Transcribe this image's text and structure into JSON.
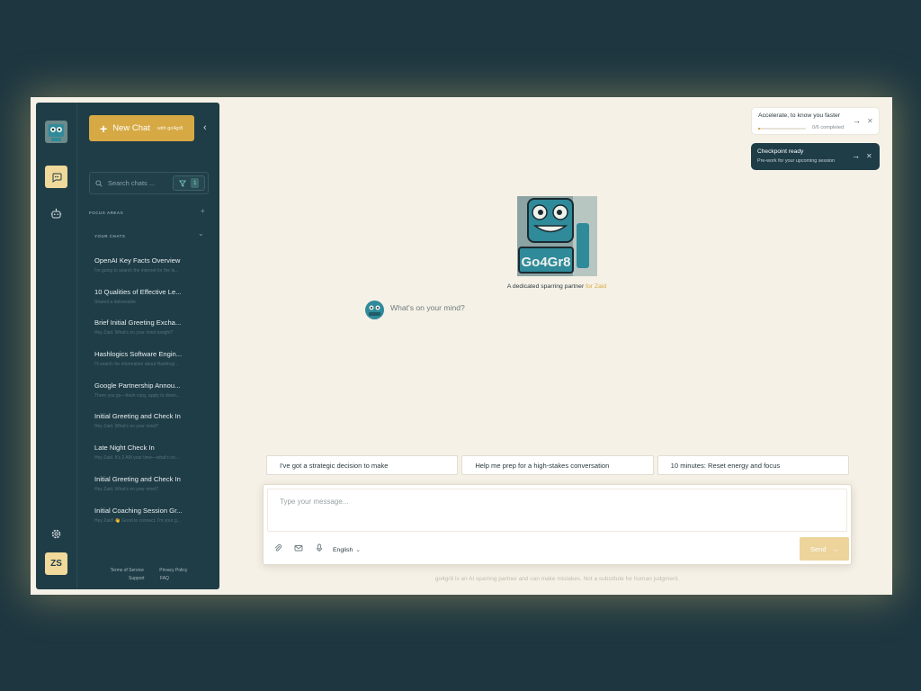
{
  "sidebar": {
    "new_chat_label": "New Chat",
    "new_chat_sub": "with go4gr8",
    "search_placeholder": "Search chats ...",
    "filter_count": "1",
    "focus_areas_label": "FOCUS AREAS",
    "your_chats_label": "YOUR CHATS",
    "chats": [
      {
        "title": "OpenAI Key Facts Overview",
        "preview": "I'm going to search the internet for the la..."
      },
      {
        "title": "10 Qualities of Effective Le...",
        "preview": "Shared a deliverable"
      },
      {
        "title": "Brief Initial Greeting Excha...",
        "preview": "Hey Zaid. What's on your mind tonight?"
      },
      {
        "title": "Hashlogics Software Engin...",
        "preview": "I'll search for information about Hashlogi..."
      },
      {
        "title": "Google Partnership Annou...",
        "preview": "There you go—fresh copy, apply to down..."
      },
      {
        "title": "Initial Greeting and Check In",
        "preview": "Hey Zaid. What's on your mind?"
      },
      {
        "title": "Late Night Check In",
        "preview": "Hey Zaid. It's 2 AM your time—what's on..."
      },
      {
        "title": "Initial Greeting and Check In",
        "preview": "Hey Zaid. What's on your mind?"
      },
      {
        "title": "Initial Coaching Session Gr...",
        "preview": "Hey Zaid! 👋 Good to connect. I'm your g..."
      }
    ],
    "footer": {
      "terms": "Terms of Service",
      "privacy": "Privacy Policy",
      "support": "Support",
      "faq": "FAQ"
    }
  },
  "rail": {
    "avatar_initials": "ZS"
  },
  "cards": {
    "accelerate": {
      "title": "Accelerate, to know you faster",
      "progress_text": "0/6 completed",
      "progress_fraction": 0.0
    },
    "checkpoint": {
      "title": "Checkpoint ready",
      "subtitle": "Pre-work for your upcoming session"
    }
  },
  "hero": {
    "logo_text": "Go4Gr8",
    "tagline_prefix": "A dedicated sparring partner",
    "tagline_name": "for Zaid",
    "prompt": "What's on your mind?"
  },
  "suggestions": [
    "I've got a strategic decision to make",
    "Help me prep for a high-stakes conversation",
    "10 minutes: Reset energy and focus"
  ],
  "composer": {
    "placeholder": "Type your message...",
    "language": "English",
    "send_label": "Send"
  },
  "disclaimer": "go4gr8 is an AI sparring partner and can make mistakes. Not a substitute for human judgment.",
  "colors": {
    "brand_dark": "#1f3d47",
    "accent_gold": "#d6a944",
    "canvas": "#f6f1e6"
  }
}
